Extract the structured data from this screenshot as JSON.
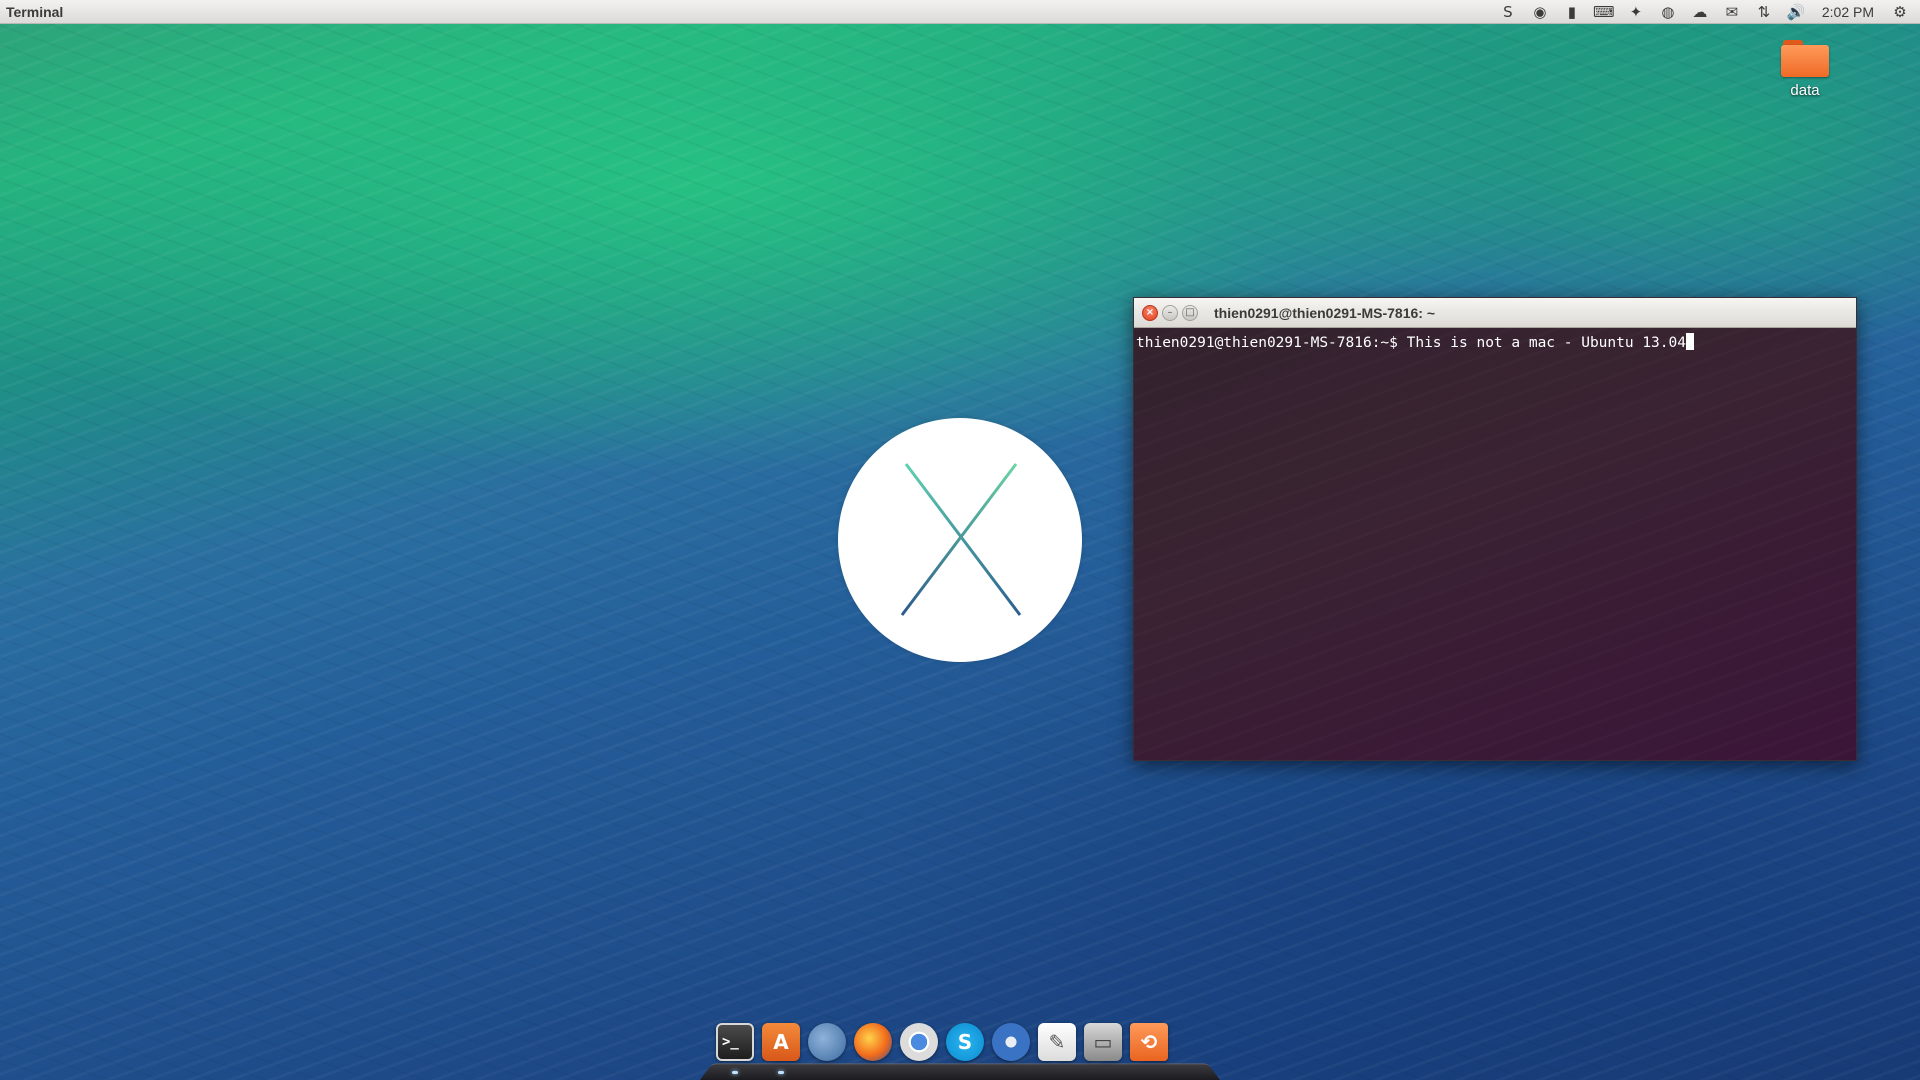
{
  "top_panel": {
    "app_name": "Terminal",
    "clock": "2:02 PM",
    "indicators": [
      {
        "name": "skype-indicator-icon",
        "glyph": "S"
      },
      {
        "name": "update-indicator-icon",
        "glyph": "◉"
      },
      {
        "name": "battery-indicator-icon",
        "glyph": "▮"
      },
      {
        "name": "keyboard-indicator-icon",
        "glyph": "⌨"
      },
      {
        "name": "dropbox-indicator-icon",
        "glyph": "✦"
      },
      {
        "name": "browser-indicator-icon",
        "glyph": "◍"
      },
      {
        "name": "cloud-indicator-icon",
        "glyph": "☁"
      },
      {
        "name": "mail-indicator-icon",
        "glyph": "✉"
      },
      {
        "name": "network-indicator-icon",
        "glyph": "⇅"
      },
      {
        "name": "volume-indicator-icon",
        "glyph": "🔊"
      }
    ],
    "session_glyph": "⚙"
  },
  "desktop": {
    "folder_label": "data"
  },
  "terminal": {
    "title": "thien0291@thien0291-MS-7816: ~",
    "close_glyph": "×",
    "minimize_glyph": "–",
    "maximize_glyph": "□",
    "line": "thien0291@thien0291-MS-7816:~$ This is not a mac - Ubuntu 13.04"
  },
  "dock": {
    "items": [
      {
        "name": "dock-terminal",
        "glyph": ">_",
        "cls": "ic-terminal",
        "running": true
      },
      {
        "name": "dock-software-center",
        "glyph": "A",
        "cls": "ic-software",
        "running": true
      },
      {
        "name": "dock-thunderbird",
        "glyph": "",
        "cls": "ic-thunder",
        "running": false
      },
      {
        "name": "dock-firefox",
        "glyph": "",
        "cls": "ic-firefox",
        "running": false
      },
      {
        "name": "dock-chrome",
        "glyph": "",
        "cls": "ic-chrome",
        "running": false
      },
      {
        "name": "dock-skype",
        "glyph": "S",
        "cls": "ic-skype",
        "running": false
      },
      {
        "name": "dock-safari",
        "glyph": "",
        "cls": "ic-safari",
        "running": false
      },
      {
        "name": "dock-textedit",
        "glyph": "✎",
        "cls": "ic-textedit",
        "running": false
      },
      {
        "name": "dock-file-cabinet",
        "glyph": "▭",
        "cls": "ic-cabinet",
        "running": false
      },
      {
        "name": "dock-time-machine",
        "glyph": "⟲",
        "cls": "ic-timemachine",
        "running": false
      }
    ]
  }
}
